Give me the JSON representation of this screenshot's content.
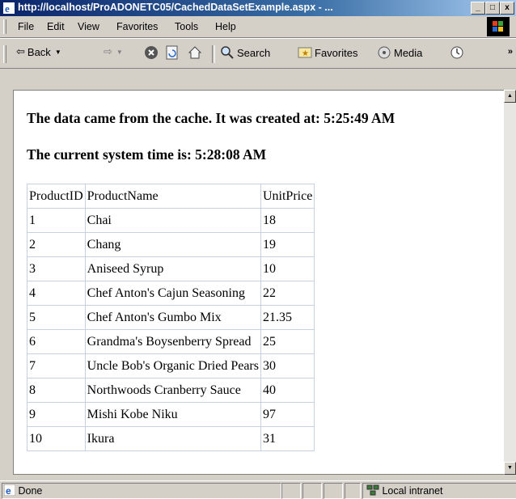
{
  "window": {
    "title": "http://localhost/ProADONETC05/CachedDataSetExample.aspx - ...",
    "btn_min": "_",
    "btn_max": "□",
    "btn_close": "x"
  },
  "menu": {
    "items": [
      "File",
      "Edit",
      "View",
      "Favorites",
      "Tools",
      "Help"
    ]
  },
  "toolbar": {
    "back": "Back",
    "search": "Search",
    "favorites": "Favorites",
    "media": "Media",
    "more": "»"
  },
  "page": {
    "cache_message": "The data came from the cache. It was created at: 5:25:49 AM",
    "time_message": "The current system time is: 5:28:08 AM",
    "headers": [
      "ProductID",
      "ProductName",
      "UnitPrice"
    ],
    "rows": [
      [
        "1",
        "Chai",
        "18"
      ],
      [
        "2",
        "Chang",
        "19"
      ],
      [
        "3",
        "Aniseed Syrup",
        "10"
      ],
      [
        "4",
        "Chef Anton's Cajun Seasoning",
        "22"
      ],
      [
        "5",
        "Chef Anton's Gumbo Mix",
        "21.35"
      ],
      [
        "6",
        "Grandma's Boysenberry Spread",
        "25"
      ],
      [
        "7",
        "Uncle Bob's Organic Dried Pears",
        "30"
      ],
      [
        "8",
        "Northwoods Cranberry Sauce",
        "40"
      ],
      [
        "9",
        "Mishi Kobe Niku",
        "97"
      ],
      [
        "10",
        "Ikura",
        "31"
      ]
    ]
  },
  "status": {
    "done": "Done",
    "zone": "Local intranet"
  },
  "colors": {
    "title_gradient_start": "#0a246a",
    "title_gradient_end": "#a6caf0",
    "chrome": "#d4d0c8",
    "table_border": "#c8d0e4"
  }
}
